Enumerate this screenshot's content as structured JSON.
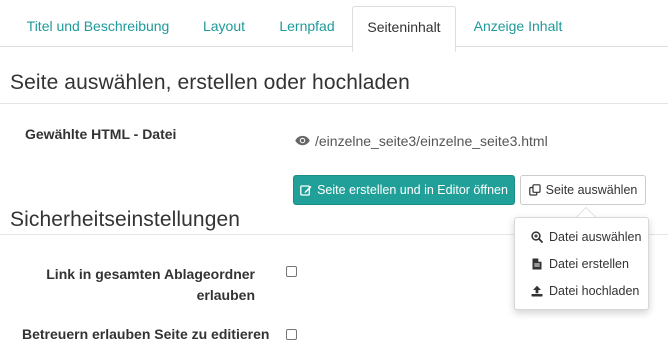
{
  "tabs": [
    {
      "label": "Titel und Beschreibung",
      "active": false
    },
    {
      "label": "Layout",
      "active": false
    },
    {
      "label": "Lernpfad",
      "active": false
    },
    {
      "label": "Seiteninhalt",
      "active": true
    },
    {
      "label": "Anzeige Inhalt",
      "active": false
    }
  ],
  "page_section": {
    "heading": "Seite auswählen, erstellen oder hochladen",
    "file_label": "Gewählte HTML - Datei",
    "file_path": "/einzelne_seite3/einzelne_seite3.html",
    "file_icon": "eye-icon",
    "create_button": "Seite erstellen und in Editor öffnen",
    "create_icon": "edit-icon",
    "select_button": "Seite auswählen",
    "select_icon": "copy-icon"
  },
  "dropdown": {
    "items": [
      {
        "label": "Datei auswählen",
        "icon": "search-plus-icon"
      },
      {
        "label": "Datei erstellen",
        "icon": "file-icon"
      },
      {
        "label": "Datei hochladen",
        "icon": "upload-icon"
      }
    ]
  },
  "security_section": {
    "heading": "Sicherheitseinstellungen",
    "options": [
      {
        "label_line1": "Link in gesamten Ablageordner",
        "label_line2": "erlauben",
        "checked": false
      },
      {
        "label": "Betreuern erlauben Seite zu editieren",
        "checked": false
      }
    ]
  },
  "colors": {
    "accent": "#1f9a9a",
    "primary_button": "#21a099"
  }
}
